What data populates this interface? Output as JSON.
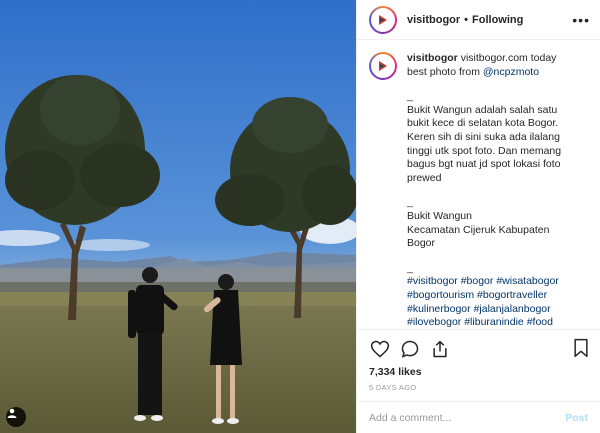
{
  "header": {
    "username": "visitbogor",
    "separator": "•",
    "follow_status": "Following",
    "more_icon": "more-horizontal-icon"
  },
  "caption": {
    "username": "visitbogor",
    "intro": "visitbogor.com today best photo from ",
    "mention": "@ncpzmoto",
    "sep1": "_",
    "paragraph": "Bukit Wangun adalah salah satu bukit kece di selatan kota Bogor. Keren sih di sini suka ada ilalang tinggi utk spot foto. Dan memang bagus bgt nuat jd spot lokasi foto prewed",
    "sep2": "_",
    "place_name": "Bukit Wangun",
    "place_address": "Kecamatan Cijeruk Kabupaten Bogor",
    "sep3": "_",
    "hashtags": [
      "#visitbogor",
      "#bogor",
      "#wisatabogor",
      "#bogortourism",
      "#bogortraveller",
      "#kulinerbogor",
      "#jalanjalanbogor",
      "#ilovebogor",
      "#liburanindie",
      "#food"
    ]
  },
  "actions": {
    "icons": [
      "heart-icon",
      "comment-icon",
      "share-icon",
      "bookmark-icon"
    ],
    "likes": "7,334 likes",
    "date": "5 DAYS AGO"
  },
  "comment": {
    "placeholder": "Add a comment...",
    "post_label": "Post"
  },
  "colors": {
    "link": "#003569",
    "muted": "#999999",
    "post_disabled": "#b2dffc",
    "sky": "#3a7bd0"
  }
}
